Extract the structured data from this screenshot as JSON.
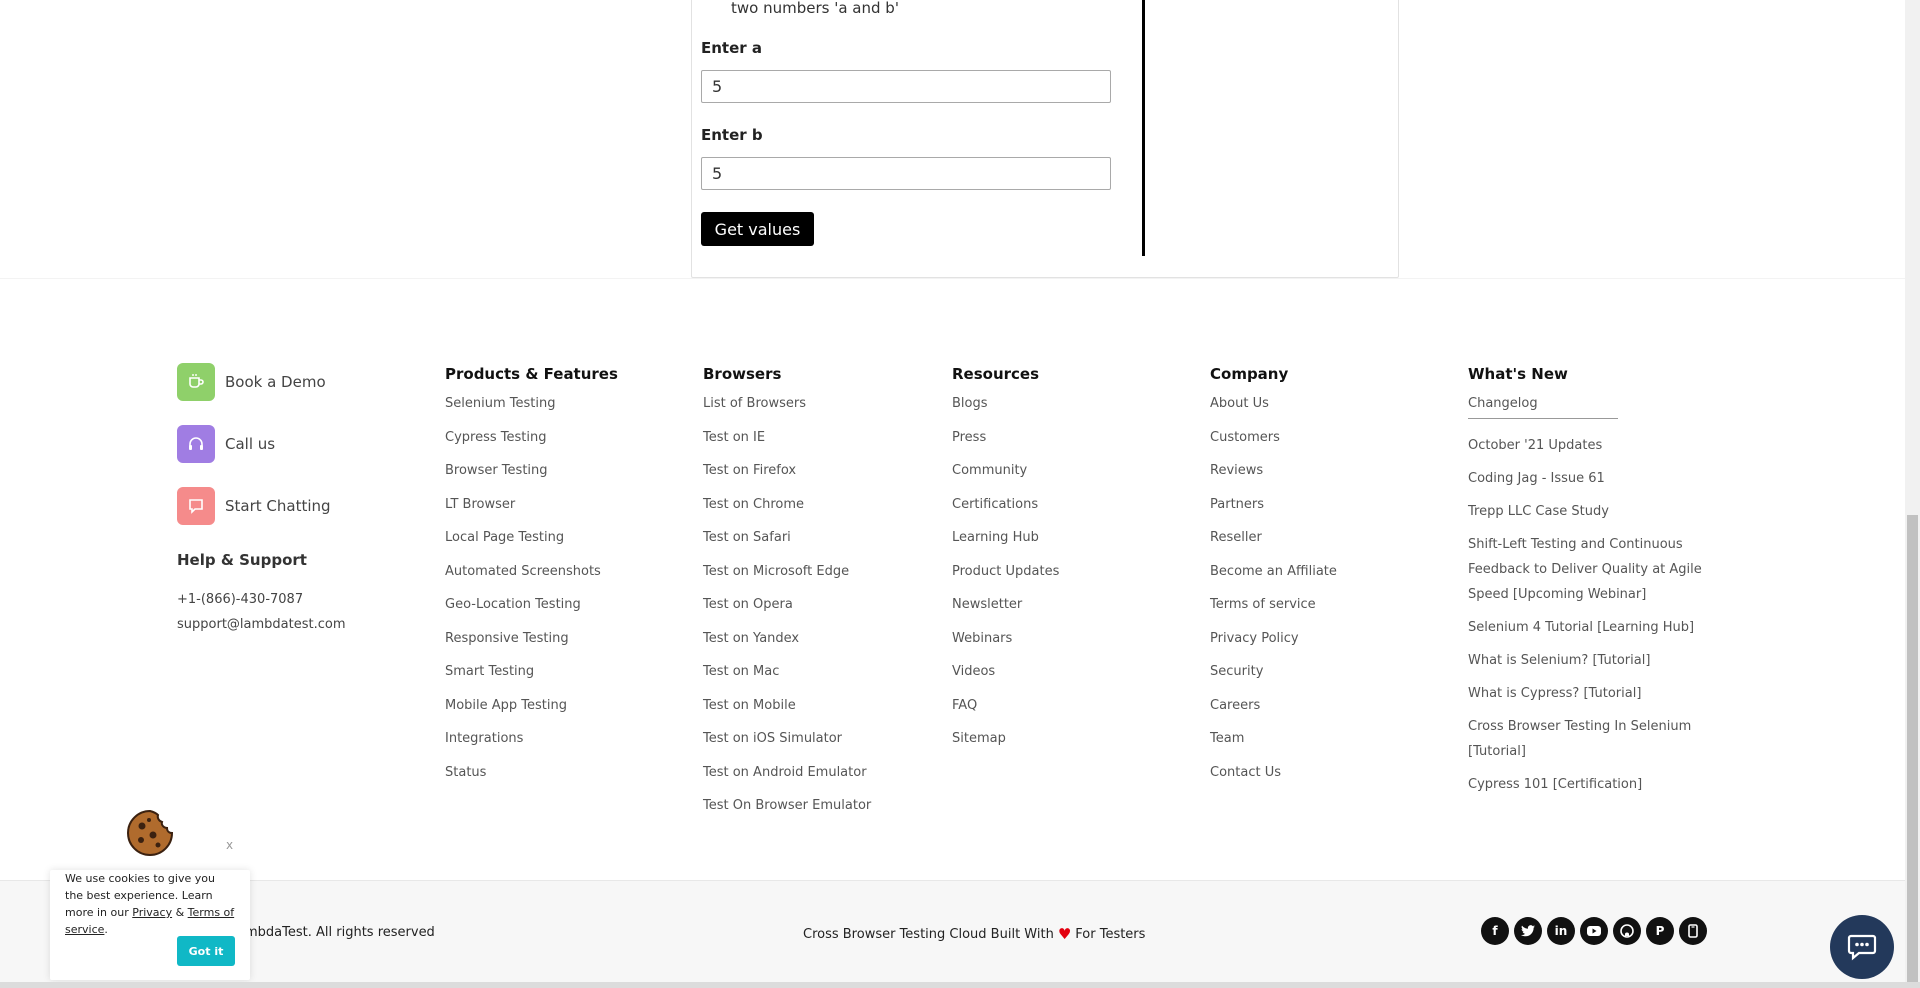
{
  "demo": {
    "description": "two numbers 'a and b'",
    "label_a": "Enter a",
    "value_a": "5",
    "label_b": "Enter b",
    "value_b": "5",
    "button": "Get values"
  },
  "contact": {
    "book_demo": "Book a Demo",
    "call_us": "Call us",
    "start_chatting": "Start Chatting",
    "help_title": "Help & Support",
    "phone": "+1-(866)-430-7087",
    "email": "support@lambdatest.com",
    "colors": {
      "book": "#8fd06a",
      "call": "#a07de3",
      "chat": "#f58b8b"
    },
    "icons": {
      "book": "cup-icon",
      "call": "headset-icon",
      "chat": "chat-square-icon"
    }
  },
  "columns": {
    "products": {
      "title": "Products & Features",
      "items": [
        "Selenium Testing",
        "Cypress Testing",
        "Browser Testing",
        "LT Browser",
        "Local Page Testing",
        "Automated Screenshots",
        "Geo-Location Testing",
        "Responsive Testing",
        "Smart Testing",
        "Mobile App Testing",
        "Integrations",
        "Status"
      ]
    },
    "browsers": {
      "title": "Browsers",
      "items": [
        "List of Browsers",
        "Test on IE",
        "Test on Firefox",
        "Test on Chrome",
        "Test on Safari",
        "Test on Microsoft Edge",
        "Test on Opera",
        "Test on Yandex",
        "Test on Mac",
        "Test on Mobile",
        "Test on iOS Simulator",
        "Test on Android Emulator",
        "Test On Browser Emulator"
      ]
    },
    "resources": {
      "title": "Resources",
      "items": [
        "Blogs",
        "Press",
        "Community",
        "Certifications",
        "Learning Hub",
        "Product Updates",
        "Newsletter",
        "Webinars",
        "Videos",
        "FAQ",
        "Sitemap"
      ]
    },
    "company": {
      "title": "Company",
      "items": [
        "About Us",
        "Customers",
        "Reviews",
        "Partners",
        "Reseller",
        "Become an Affiliate",
        "Terms of service",
        "Privacy Policy",
        "Security",
        "Careers",
        "Team",
        "Contact Us"
      ]
    },
    "whats_new": {
      "title": "What's New",
      "changelog": "Changelog",
      "items": [
        "October '21 Updates",
        "Coding Jag - Issue 61",
        "Trepp LLC Case Study",
        "Shift-Left Testing and Continuous Feedback to Deliver Quality at Agile Speed [Upcoming Webinar]",
        "Selenium 4 Tutorial [Learning Hub]",
        "What is Selenium? [Tutorial]",
        "What is Cypress? [Tutorial]",
        "Cross Browser Testing In Selenium [Tutorial]",
        "Cypress 101 [Certification]"
      ]
    }
  },
  "bottom": {
    "copyright": "mbdaTest. All rights reserved",
    "tagline_before": "Cross Browser Testing Cloud Built With",
    "tagline_after": "For Testers",
    "heart_color": "#e3000f",
    "social_icons": [
      "facebook-icon",
      "twitter-icon",
      "linkedin-icon",
      "youtube-icon",
      "github-icon",
      "pinterest-icon",
      "mobile-app-icon"
    ]
  },
  "cookie": {
    "close": "x",
    "text_before": "We use cookies to give you the best experience. Learn more in our",
    "privacy": "Privacy",
    "amp": "&",
    "terms": "Terms of service",
    "period": ".",
    "button": "Got it",
    "button_color": "#10b8c6"
  }
}
